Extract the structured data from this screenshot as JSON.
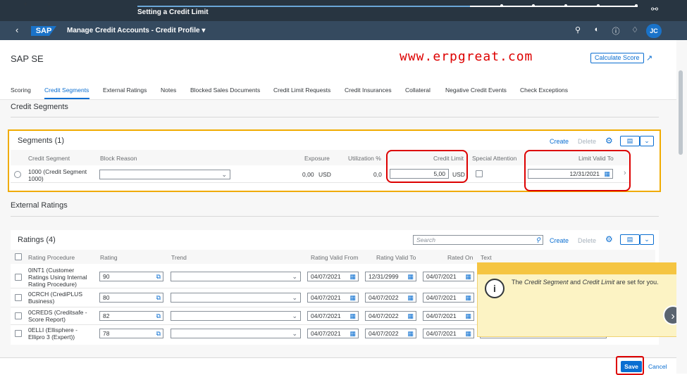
{
  "topbar": {
    "step_title": "Setting a Credit Limit",
    "back_icon": "chevron-left-icon",
    "forward_icon": "chevron-right-icon",
    "share_icon": "share-icon",
    "progress_fraction": 0.67
  },
  "shell": {
    "logo": "SAP",
    "app_title": "Manage Credit Accounts - Credit Profile ▾",
    "avatar_initials": "JC"
  },
  "header": {
    "company": "SAP SE",
    "watermark": "www.erpgreat.com",
    "calc_button": "Calculate Score"
  },
  "tabs": [
    "Scoring",
    "Credit Segments",
    "External Ratings",
    "Notes",
    "Blocked Sales Documents",
    "Credit Limit Requests",
    "Credit Insurances",
    "Collateral",
    "Negative Credit Events",
    "Check Exceptions"
  ],
  "active_tab": "Credit Segments",
  "credit_segments": {
    "section_title": "Credit Segments",
    "table_title": "Segments (1)",
    "create_label": "Create",
    "delete_label": "Delete",
    "columns": {
      "segment": "Credit Segment",
      "block_reason": "Block Reason",
      "exposure": "Exposure",
      "utilization": "Utilization %",
      "credit_limit": "Credit Limit",
      "special_attention": "Special Attention",
      "limit_valid_to": "Limit Valid To"
    },
    "row": {
      "segment_line1": "1000 (Credit Segment",
      "segment_line2": "1000)",
      "block_reason": "",
      "exposure": "0,00",
      "exposure_currency": "USD",
      "utilization": "0,0",
      "credit_limit": "5,00",
      "credit_currency": "USD",
      "limit_valid_to": "12/31/2021"
    }
  },
  "external_ratings": {
    "section_title": "External Ratings",
    "table_title": "Ratings (4)",
    "search_placeholder": "Search",
    "create_label": "Create",
    "delete_label": "Delete",
    "columns": {
      "procedure": "Rating Procedure",
      "rating": "Rating",
      "trend": "Trend",
      "valid_from": "Rating Valid From",
      "valid_to": "Rating Valid To",
      "rated_on": "Rated On",
      "text": "Text"
    },
    "rows": [
      {
        "proc": [
          "0INT1 (Customer",
          "Ratings Using Internal",
          "Rating Procedure)"
        ],
        "rating": "90",
        "valid_from": "04/07/2021",
        "valid_to": "12/31/2999",
        "rated_on": "04/07/2021"
      },
      {
        "proc": [
          "0CRCH (CrediPLUS",
          "Business)"
        ],
        "rating": "80",
        "valid_from": "04/07/2021",
        "valid_to": "04/07/2022",
        "rated_on": "04/07/2021"
      },
      {
        "proc": [
          "0CREDS (Creditsafe -",
          "Score Report)"
        ],
        "rating": "82",
        "valid_from": "04/07/2021",
        "valid_to": "04/07/2022",
        "rated_on": "04/07/2021"
      },
      {
        "proc": [
          "0ELLI (Ellisphere -",
          "Ellipro 3 (Expert))"
        ],
        "rating": "78",
        "valid_from": "04/07/2021",
        "valid_to": "04/07/2022",
        "rated_on": "04/07/2021"
      }
    ]
  },
  "tooltip": {
    "text_pre": "The ",
    "em1": "Credit Segment",
    "text_mid": " and ",
    "em2": "Credit Limit",
    "text_post": " are set for you."
  },
  "footer": {
    "save": "Save",
    "cancel": "Cancel"
  }
}
